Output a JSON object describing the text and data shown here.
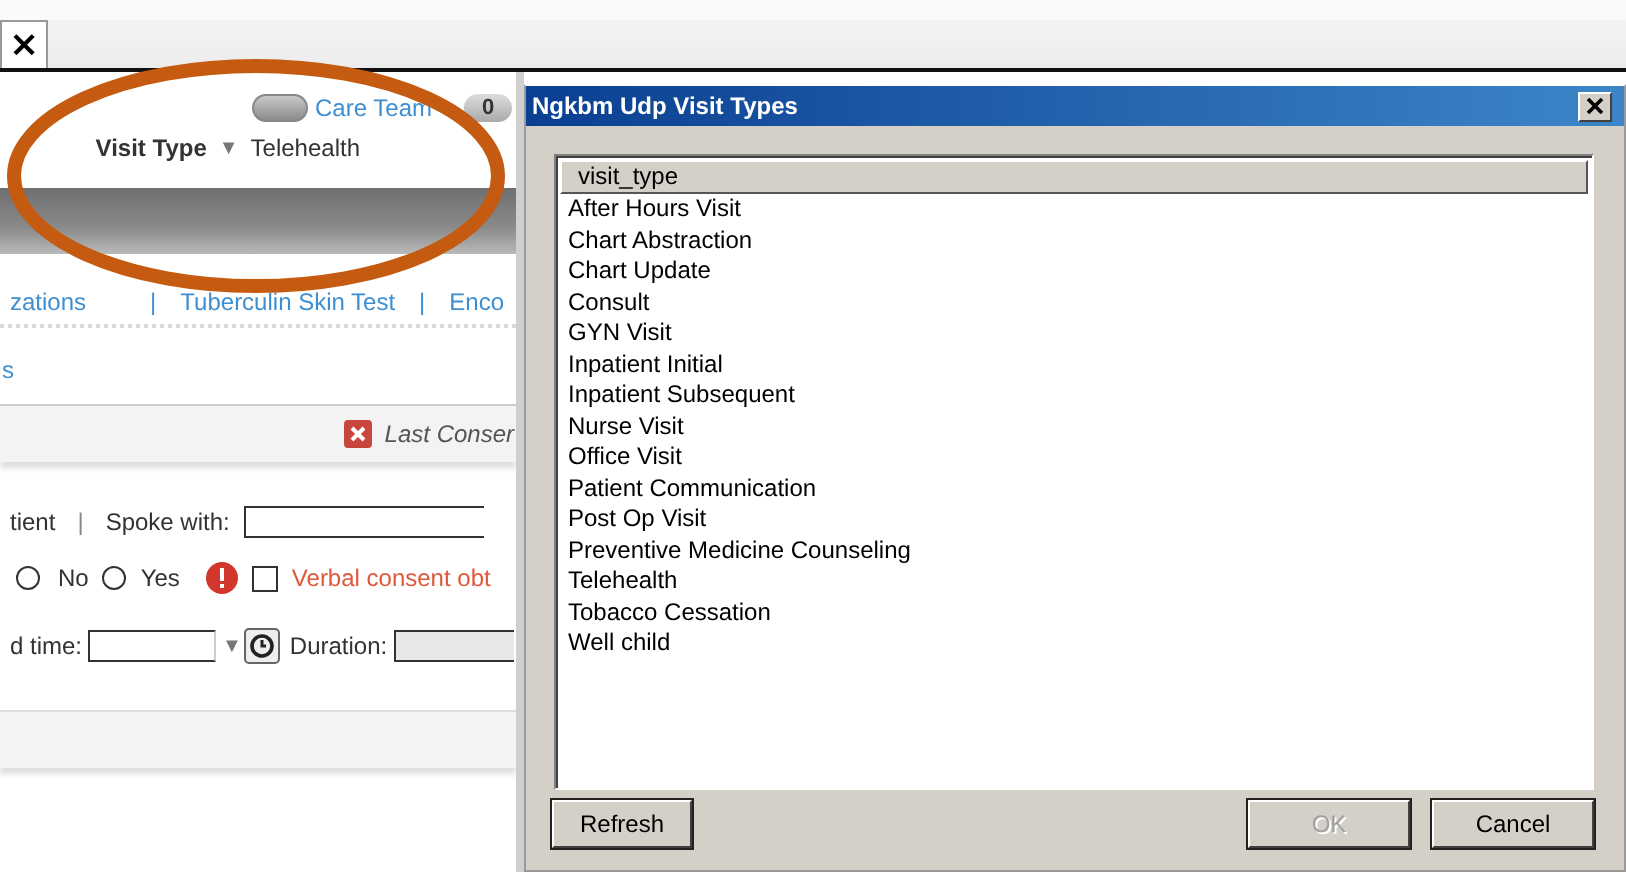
{
  "tab": {
    "close": "×"
  },
  "header": {
    "care_team": {
      "label": "Care Team",
      "on": false
    },
    "badge": "0",
    "visit_type": {
      "label": "Visit Type",
      "caret": "▼",
      "value": "Telehealth"
    }
  },
  "links": [
    "zations",
    "Tuberculin Skin Test",
    "Enco"
  ],
  "link_separator": "|",
  "section_link": "s",
  "consent_banner": "Last Conser",
  "contact": {
    "label": "tient",
    "separator": "|",
    "spoke_label": "Spoke with:"
  },
  "consent": {
    "options": [
      {
        "label": "No",
        "selected": false
      },
      {
        "label": "Yes",
        "selected": false
      }
    ],
    "verbal_checked": false,
    "verbal_label": "Verbal consent obt"
  },
  "time": {
    "label": "d time:",
    "caret": "▼",
    "duration_label": "Duration:"
  },
  "dialog": {
    "title": "Ngkbm Udp Visit Types",
    "column": "visit_type",
    "items": [
      "After Hours Visit",
      "Chart Abstraction",
      "Chart Update",
      "Consult",
      "GYN Visit",
      "Inpatient Initial",
      "Inpatient Subsequent",
      "Nurse Visit",
      "Office Visit",
      "Patient Communication",
      "Post Op Visit",
      "Preventive Medicine Counseling",
      "Telehealth",
      "Tobacco Cessation",
      "Well child"
    ],
    "left_buttons": [
      {
        "label": "Refresh",
        "disabled": false
      }
    ],
    "right_buttons": [
      {
        "label": "OK",
        "disabled": true
      },
      {
        "label": "Cancel",
        "disabled": false
      }
    ]
  }
}
